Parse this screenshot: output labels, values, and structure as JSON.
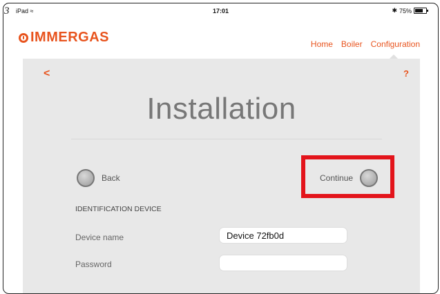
{
  "step_number": "3",
  "status_bar": {
    "device": "iPad",
    "time": "17:01",
    "battery": "75%",
    "battery_level": 0.75
  },
  "brand": {
    "logo_text": "IMMERGAS",
    "accent_color": "#e8541e"
  },
  "nav": {
    "items": [
      "Home",
      "Boiler",
      "Configuration"
    ],
    "active": "Configuration"
  },
  "page": {
    "back_symbol": "<",
    "help_symbol": "?",
    "title": "Installation",
    "back_label": "Back",
    "continue_label": "Continue",
    "section_label": "IDENTIFICATION DEVICE"
  },
  "form": {
    "device_name_label": "Device name",
    "device_name_value": "Device 72fb0d",
    "password_label": "Password",
    "password_value": ""
  },
  "highlight_color": "#e3141b"
}
